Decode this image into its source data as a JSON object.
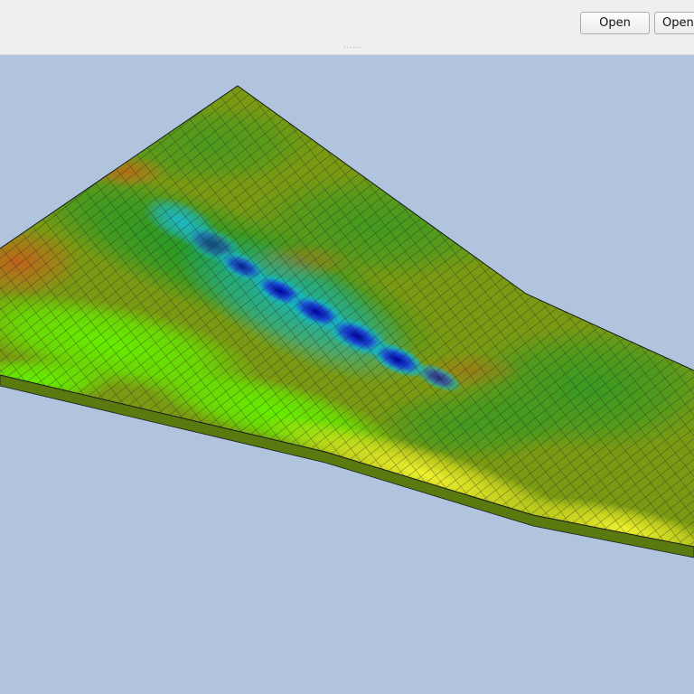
{
  "toolbar": {
    "open_label": "Open",
    "open2_label": "Open",
    "grip_glyph": "......"
  },
  "viewport": {
    "background_color": "#b0c4de",
    "mesh_edge_color": "#1a1a1a",
    "colormap": [
      "#00008b",
      "#1e90ff",
      "#00c8c8",
      "#1faa2a",
      "#66ee00",
      "#ffff33",
      "#cc9900",
      "#b85a1c"
    ]
  }
}
